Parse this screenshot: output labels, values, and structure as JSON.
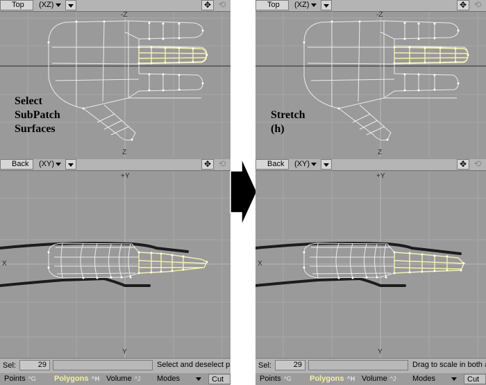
{
  "panels": [
    {
      "id": "left",
      "top_view": {
        "name": "Top",
        "mode": "(XZ)"
      },
      "bottom_view": {
        "name": "Back",
        "mode": "(XY)"
      },
      "axis_labels": {
        "top_vertical_top": "-Z",
        "top_vertical_bottom": "Z",
        "bottom_vertical_top": "+Y",
        "bottom_horizontal_left": "X",
        "bottom_vertical_bottom": "Y"
      },
      "overlay_text": "Select\nSubPatch\nSurfaces",
      "status": {
        "sel_label": "Sel:",
        "sel_count": "29",
        "hint": "Select and deselect p"
      }
    },
    {
      "id": "right",
      "top_view": {
        "name": "Top",
        "mode": "(XZ)"
      },
      "bottom_view": {
        "name": "Back",
        "mode": "(XY)"
      },
      "axis_labels": {
        "top_vertical_top": "-Z",
        "top_vertical_bottom": "Z",
        "bottom_vertical_top": "+Y",
        "bottom_horizontal_left": "X",
        "bottom_vertical_bottom": "Y"
      },
      "overlay_text": "Stretch\n(h)",
      "status": {
        "sel_label": "Sel:",
        "sel_count": "29",
        "hint": "Drag to scale in both a"
      }
    }
  ],
  "modebar": {
    "points": {
      "label": "Points",
      "key": "^G"
    },
    "polygons": {
      "label": "Polygons",
      "key": "^H"
    },
    "volume": {
      "label": "Volume",
      "key": "^J"
    },
    "modes": {
      "label": "Modes"
    },
    "cut": {
      "label": "Cut"
    }
  },
  "icons": {
    "move": "move-icon",
    "rotate": "rotate-icon",
    "arrow": "right-arrow-icon"
  },
  "colors": {
    "viewport_bg": "#9a9a9a",
    "wire": "#e8e8e8",
    "selection": "#f6f3b0",
    "shadow": "#1c1c1c"
  }
}
